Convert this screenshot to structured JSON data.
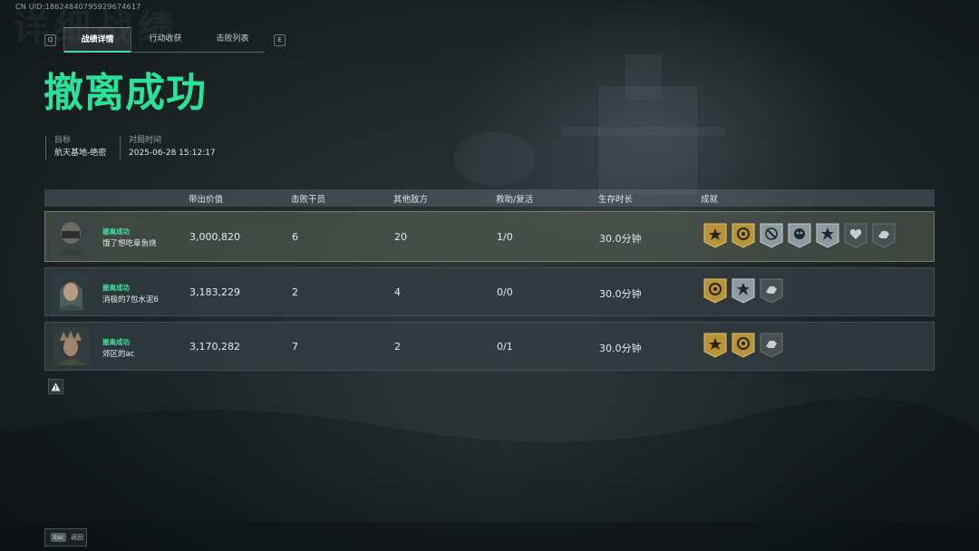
{
  "header": {
    "uid": "CN UID:18624840795929674617",
    "watermark": "详细战绩",
    "key_left": "Q",
    "key_right": "E"
  },
  "tabs": [
    {
      "label": "战绩详情",
      "active": true
    },
    {
      "label": "行动收获",
      "active": false
    },
    {
      "label": "击败列表",
      "active": false
    }
  ],
  "result": {
    "title": "撤离成功",
    "target_label": "目标",
    "target_value": "航天基地-绝密",
    "time_label": "对局时间",
    "time_value": "2025-06-28 15:12:17"
  },
  "table": {
    "headers": [
      "带出价值",
      "击败干员",
      "其他敌方",
      "救助/复活",
      "生存时长",
      "成就"
    ],
    "rows": [
      {
        "status": "撤离成功",
        "name": "饿了想吃章鱼烧",
        "value": "3,000,820",
        "kills": "6",
        "other": "20",
        "assist": "1/0",
        "time": "30.0分钟",
        "badges": [
          "gold-star-icon",
          "gold-compass-icon",
          "silver-sword-icon",
          "silver-skull-icon",
          "silver-star-icon",
          "dark-heart-icon",
          "dark-hand-icon"
        ]
      },
      {
        "status": "撤离成功",
        "name": "消极的7包水泥6",
        "value": "3,183,229",
        "kills": "2",
        "other": "4",
        "assist": "0/0",
        "time": "30.0分钟",
        "badges": [
          "gold-compass-icon",
          "silver-star-icon",
          "dark-hand-icon"
        ]
      },
      {
        "status": "撤离成功",
        "name": "郊区的ac",
        "value": "3,170,282",
        "kills": "7",
        "other": "2",
        "assist": "0/1",
        "time": "30.0分钟",
        "badges": [
          "gold-star-icon",
          "gold-compass-icon",
          "dark-hand-icon"
        ]
      }
    ]
  },
  "footer": {
    "esc_key": "Esc",
    "back_label": "返回"
  },
  "colors": {
    "accent": "#29e39b",
    "gold_badge": "#b89338",
    "silver_badge": "#8d9a9f",
    "dark_badge": "#4a4f52"
  }
}
